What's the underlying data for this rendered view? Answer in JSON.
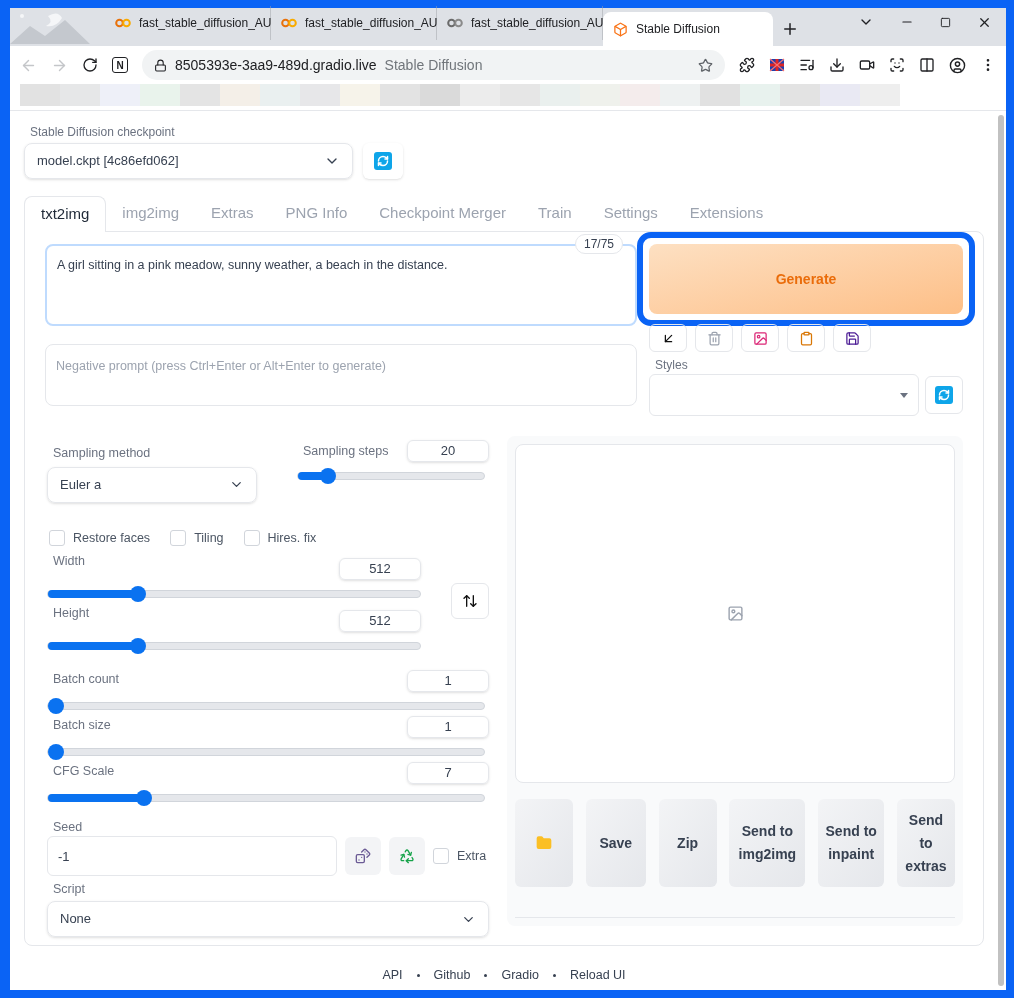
{
  "browser": {
    "tabs": [
      {
        "title": "fast_stable_diffusion_AU",
        "selected": false,
        "kind": "colab"
      },
      {
        "title": "fast_stable_diffusion_AU",
        "selected": false,
        "kind": "colab"
      },
      {
        "title": "fast_stable_diffusion_AU",
        "selected": false,
        "kind": "colab-muted"
      },
      {
        "title": "Stable Diffusion",
        "selected": true,
        "kind": "app"
      }
    ],
    "extension_badge": "N",
    "url_host": "8505393e-3aa9-489d.gradio.live",
    "url_title": "Stable Diffusion"
  },
  "checkpoint": {
    "label": "Stable Diffusion checkpoint",
    "value": "model.ckpt [4c86efd062]"
  },
  "tabs": [
    {
      "label": "txt2img",
      "selected": true
    },
    {
      "label": "img2img",
      "selected": false
    },
    {
      "label": "Extras",
      "selected": false
    },
    {
      "label": "PNG Info",
      "selected": false
    },
    {
      "label": "Checkpoint Merger",
      "selected": false
    },
    {
      "label": "Train",
      "selected": false
    },
    {
      "label": "Settings",
      "selected": false
    },
    {
      "label": "Extensions",
      "selected": false
    }
  ],
  "prompt": {
    "value": "A girl sitting in a pink meadow, sunny weather, a beach in the distance.",
    "token_count": "17/75"
  },
  "negative_prompt": {
    "placeholder": "Negative prompt (press Ctrl+Enter or Alt+Enter to generate)"
  },
  "generate": {
    "label": "Generate",
    "highlighted": true
  },
  "styles": {
    "label": "Styles"
  },
  "sampling_method": {
    "label": "Sampling method",
    "value": "Euler a"
  },
  "sampling_steps": {
    "label": "Sampling steps",
    "value": "20",
    "level": 0.13
  },
  "checkboxes": [
    {
      "label": "Restore faces",
      "checked": false
    },
    {
      "label": "Tiling",
      "checked": false
    },
    {
      "label": "Hires. fix",
      "checked": false
    }
  ],
  "size_sliders": [
    {
      "label": "Width",
      "value": "512",
      "level": 0.23
    },
    {
      "label": "Height",
      "value": "512",
      "level": 0.23
    }
  ],
  "sliders": [
    {
      "label": "Batch count",
      "value": "1",
      "level": 0
    },
    {
      "label": "Batch size",
      "value": "1",
      "level": 0
    },
    {
      "label": "CFG Scale",
      "value": "7",
      "level": 0.21
    }
  ],
  "seed": {
    "label": "Seed",
    "value": "-1"
  },
  "extra": {
    "label": "Extra",
    "checked": false
  },
  "script": {
    "label": "Script",
    "value": "None"
  },
  "output_buttons": [
    {
      "kind": "folder"
    },
    {
      "kind": "text",
      "label": "Save"
    },
    {
      "kind": "text",
      "label": "Zip"
    },
    {
      "kind": "text",
      "label": "Send to img2img"
    },
    {
      "kind": "text",
      "label": "Send to inpaint"
    },
    {
      "kind": "text",
      "label": "Send to extras"
    }
  ],
  "footer": [
    "API",
    "Github",
    "Gradio",
    "Reload UI"
  ]
}
